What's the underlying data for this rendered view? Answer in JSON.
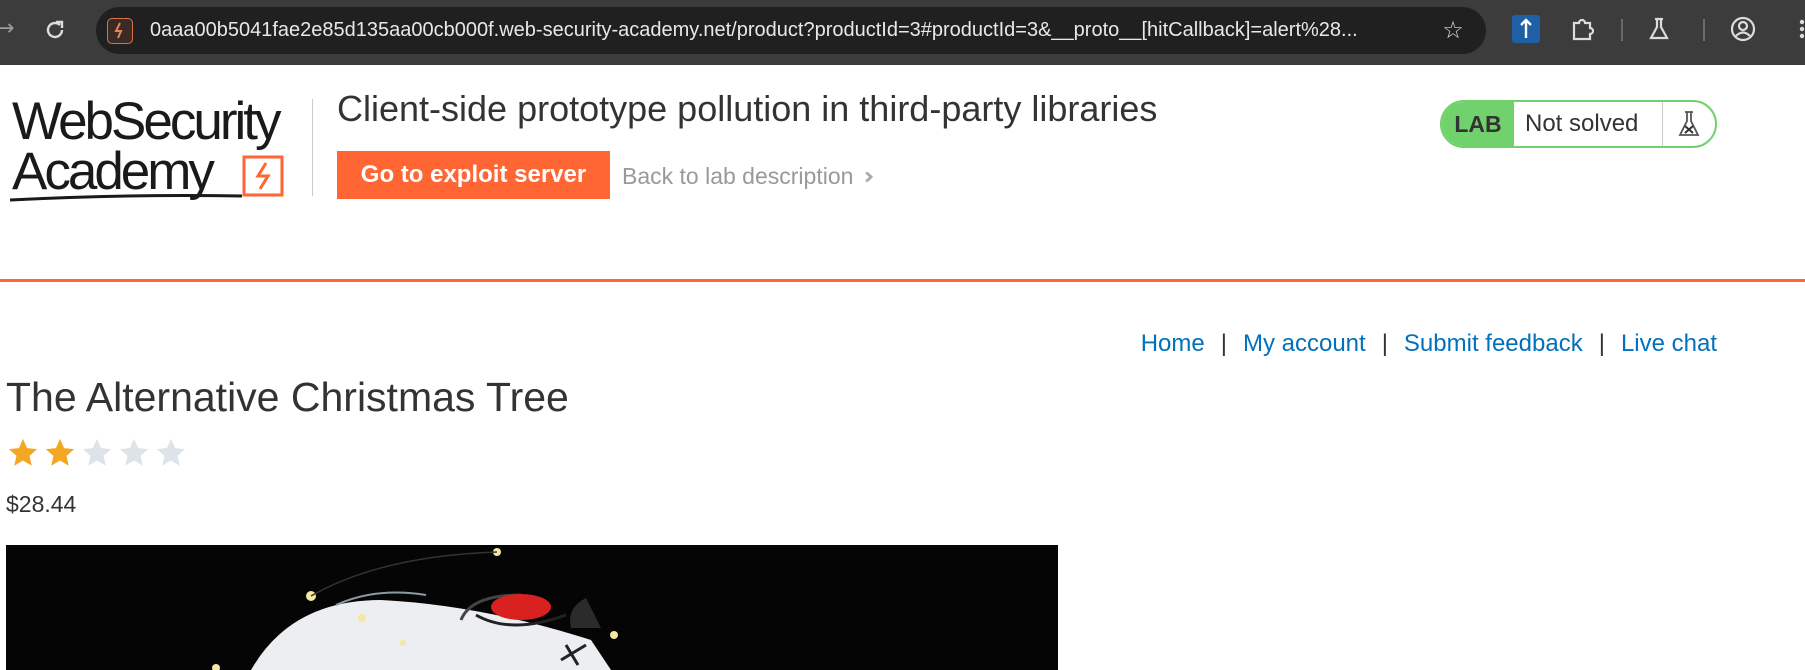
{
  "browser": {
    "url": "0aaa00b5041fae2e85d135aa00cb000f.web-security-academy.net/product?productId=3#productId=3&__proto__[hitCallback]=alert%28...",
    "star_icon": "star-outline-icon",
    "reload_icon": "reload-icon"
  },
  "lab": {
    "logo_line1": "WebSecurity",
    "logo_line2": "Academy",
    "title": "Client-side prototype pollution in third-party libraries",
    "exploit_button": "Go to exploit server",
    "back_link": "Back to lab description",
    "status_badge": "LAB",
    "status_text": "Not solved"
  },
  "colors": {
    "accent": "#ff6633",
    "status_green": "#70d16d",
    "link": "#0071bc",
    "star_filled": "#f5a623",
    "star_empty": "#dde3e8"
  },
  "nav": {
    "home": "Home",
    "account": "My account",
    "feedback": "Submit feedback",
    "chat": "Live chat"
  },
  "product": {
    "title": "The Alternative Christmas Tree",
    "rating": 2,
    "rating_max": 5,
    "price": "$28.44"
  }
}
